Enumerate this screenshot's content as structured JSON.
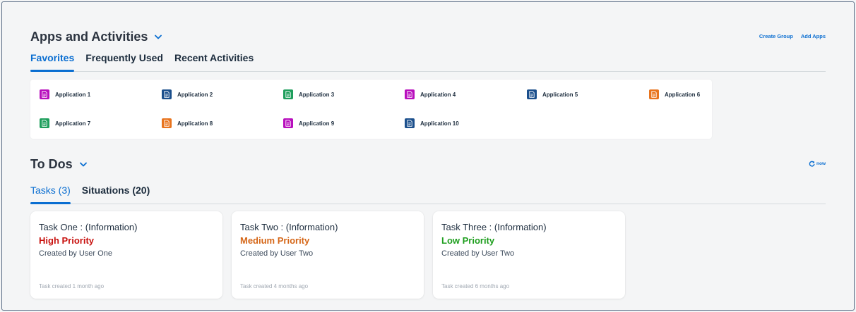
{
  "apps_section": {
    "title": "Apps and Activities",
    "links": {
      "create_group": "Create Group",
      "add_apps": "Add Apps"
    },
    "tabs": [
      {
        "label": "Favorites",
        "active": true
      },
      {
        "label": "Frequently Used",
        "active": false
      },
      {
        "label": "Recent Activities",
        "active": false
      }
    ],
    "apps": [
      {
        "label": "Application 1",
        "color": "#b80fbd",
        "icon": "document-icon"
      },
      {
        "label": "Application 2",
        "color": "#1b4f8c",
        "icon": "document-icon"
      },
      {
        "label": "Application 3",
        "color": "#1e9e5c",
        "icon": "document-icon"
      },
      {
        "label": "Application 4",
        "color": "#b80fbd",
        "icon": "document-icon"
      },
      {
        "label": "Application 5",
        "color": "#1b4f8c",
        "icon": "document-icon"
      },
      {
        "label": "Application 6",
        "color": "#e8741e",
        "icon": "document-icon"
      },
      {
        "label": "Application 7",
        "color": "#1e9e5c",
        "icon": "document-icon"
      },
      {
        "label": "Application 8",
        "color": "#e8741e",
        "icon": "document-icon"
      },
      {
        "label": "Application 9",
        "color": "#b80fbd",
        "icon": "document-icon"
      },
      {
        "label": "Application 10",
        "color": "#1b4f8c",
        "icon": "document-icon"
      }
    ]
  },
  "todos_section": {
    "title": "To Dos",
    "refresh_label": "now",
    "tabs": [
      {
        "label": "Tasks (3)",
        "active": true
      },
      {
        "label": "Situations (20)",
        "active": false
      }
    ],
    "tasks": [
      {
        "title": "Task One : (Information)",
        "priority": "High Priority",
        "priority_color": "#c8120f",
        "creator": "Created by User One",
        "meta": "Task created  1 month ago"
      },
      {
        "title": "Task Two : (Information)",
        "priority": "Medium Priority",
        "priority_color": "#d56617",
        "creator": "Created by User Two",
        "meta": "Task created  4 months ago"
      },
      {
        "title": "Task Three : (Information)",
        "priority": "Low Priority",
        "priority_color": "#1e9e1e",
        "creator": "Created by User Two",
        "meta": "Task created  6 months ago"
      }
    ]
  },
  "colors": {
    "accent": "#0a6ed1"
  }
}
